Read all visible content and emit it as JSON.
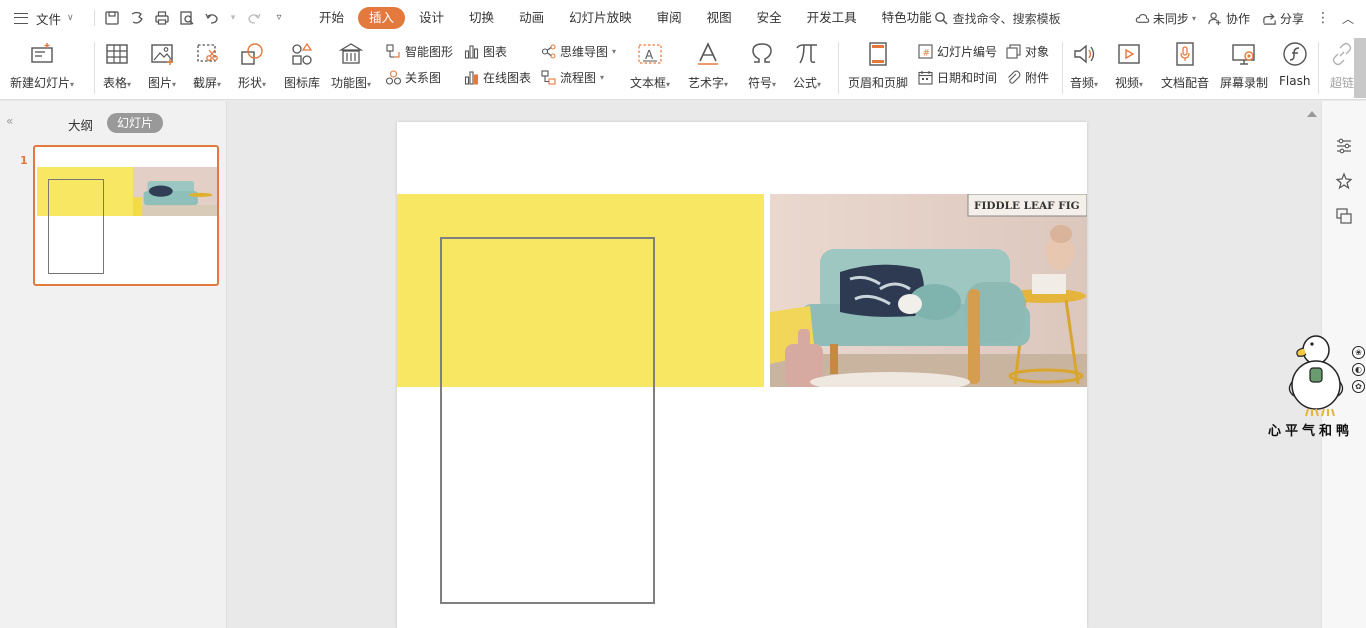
{
  "menu": {
    "file_label": "文件",
    "tabs": [
      {
        "label": "开始",
        "active": false
      },
      {
        "label": "插入",
        "active": true
      },
      {
        "label": "设计",
        "active": false
      },
      {
        "label": "切换",
        "active": false
      },
      {
        "label": "动画",
        "active": false
      },
      {
        "label": "幻灯片放映",
        "active": false
      },
      {
        "label": "审阅",
        "active": false
      },
      {
        "label": "视图",
        "active": false
      },
      {
        "label": "安全",
        "active": false
      },
      {
        "label": "开发工具",
        "active": false
      },
      {
        "label": "特色功能",
        "active": false
      }
    ],
    "search_placeholder": "查找命令、搜索模板",
    "sync_label": "未同步",
    "collab_label": "协作",
    "share_label": "分享"
  },
  "ribbon": {
    "new_slide": "新建幻灯片",
    "table": "表格",
    "picture": "图片",
    "screenshot": "截屏",
    "shape": "形状",
    "icon_library": "图标库",
    "function_chart": "功能图",
    "smart_art": "智能图形",
    "chart": "图表",
    "relation_chart": "关系图",
    "online_chart": "在线图表",
    "mind_map": "思维导图",
    "flow_chart": "流程图",
    "text_box": "文本框",
    "word_art": "艺术字",
    "symbol": "符号",
    "formula": "公式",
    "header_footer": "页眉和页脚",
    "slide_number": "幻灯片编号",
    "date_time": "日期和时间",
    "object": "对象",
    "attachment": "附件",
    "audio": "音频",
    "video": "视频",
    "doc_voice": "文档配音",
    "screen_record": "屏幕录制",
    "flash": "Flash",
    "hyperlink": "超链"
  },
  "panel": {
    "outline_label": "大纲",
    "slides_label": "幻灯片",
    "slide_number": "1"
  },
  "slide": {
    "photo_sign_text": "FIDDLE LEAF FIG"
  },
  "watermark": {
    "text": "心平气和鸭"
  },
  "colors": {
    "accent": "#e4793e",
    "yellow": "#f8e763",
    "rect_border": "#7f7f7f"
  }
}
